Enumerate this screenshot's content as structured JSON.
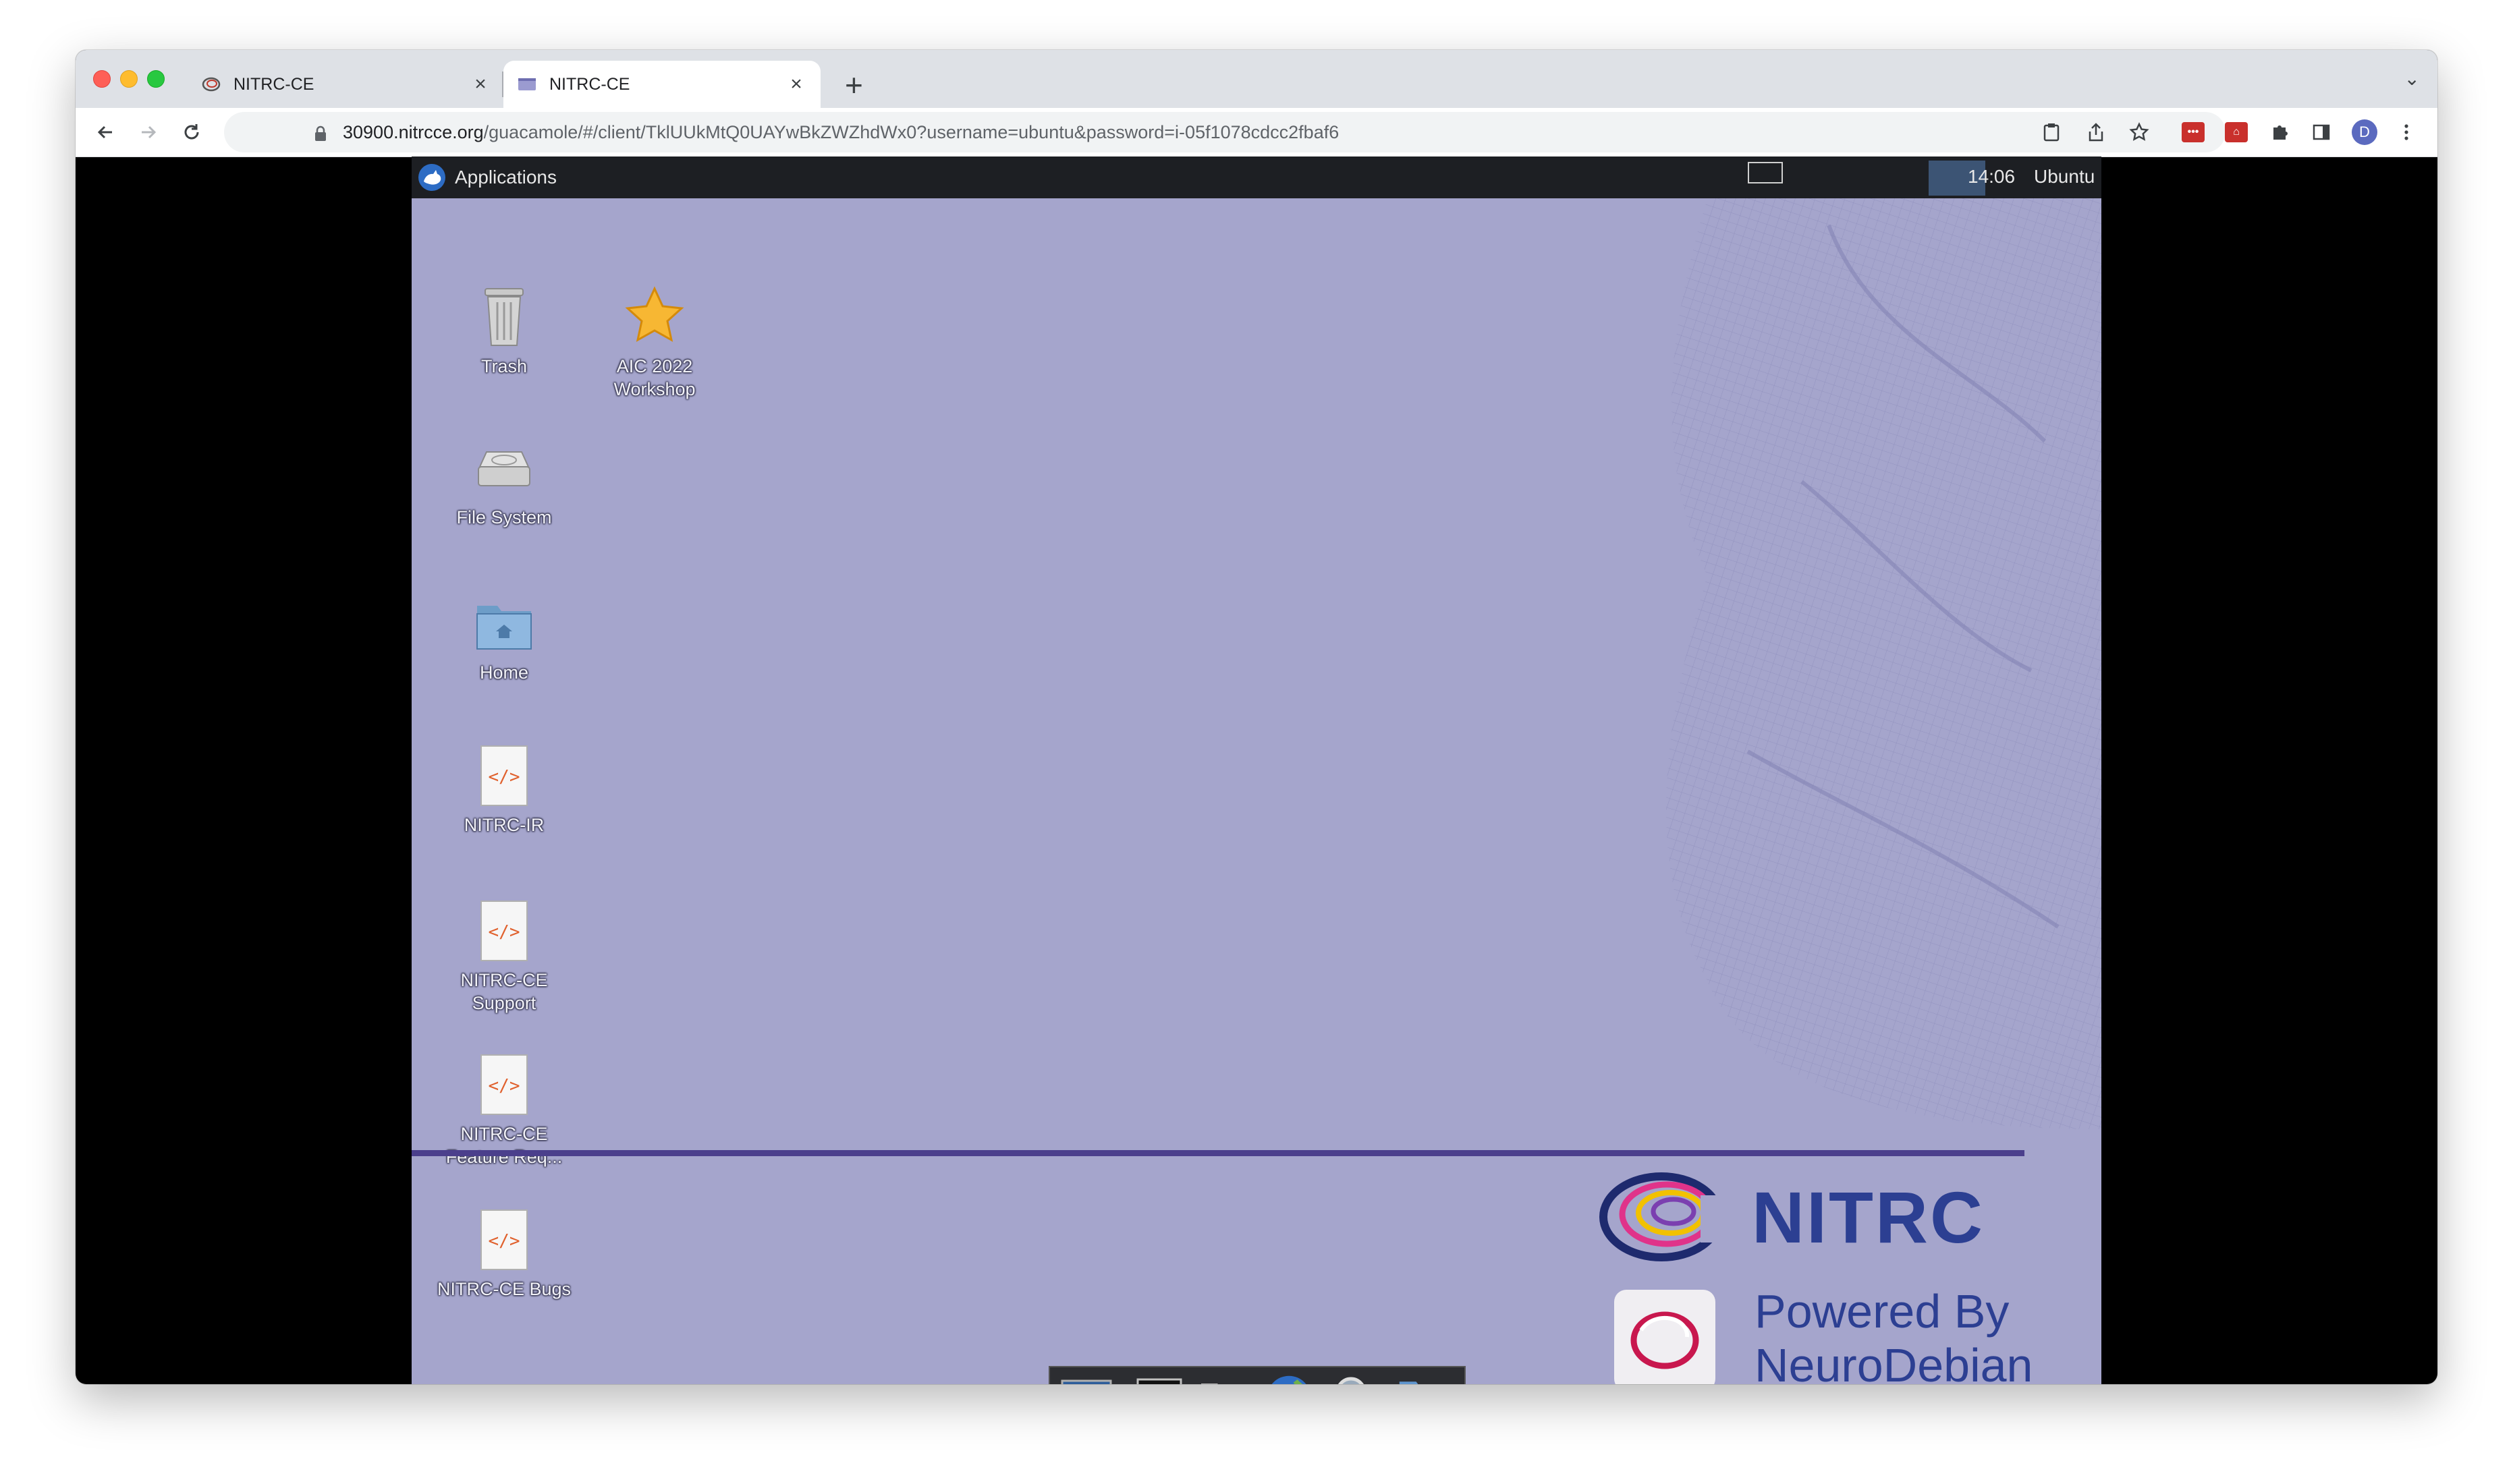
{
  "browser": {
    "tabs": [
      {
        "title": "NITRC-CE",
        "close": "×",
        "favicon": "nitrc-swirl-icon"
      },
      {
        "title": "NITRC-CE",
        "close": "×",
        "favicon": "guacamole-desktop-icon"
      }
    ],
    "new_tab": "+",
    "tab_search": "⌄",
    "url_host": "30900.nitrcce.org",
    "url_path": "/guacamole/#/client/TklUUkMtQ0UAYwBkZWZhdWx0?username=ubuntu&password=i-05f1078cdcc2fbaf6",
    "profile_initial": "D"
  },
  "desktop": {
    "panel": {
      "applications": "Applications",
      "clock": "14:06",
      "user": "Ubuntu"
    },
    "icons": [
      {
        "label": "Trash",
        "icon": "trash-icon"
      },
      {
        "label": "AIC 2022 Workshop",
        "icon": "star-icon"
      },
      {
        "label": "File System",
        "icon": "drive-icon"
      },
      {
        "label": "Home",
        "icon": "home-folder-icon"
      },
      {
        "label": "NITRC-IR",
        "icon": "html-file-icon"
      },
      {
        "label": "NITRC-CE Support",
        "icon": "html-file-icon"
      },
      {
        "label": "NITRC-CE Feature Req...",
        "icon": "html-file-icon"
      },
      {
        "label": "NITRC-CE Bugs",
        "icon": "html-file-icon"
      }
    ],
    "branding": {
      "nitrc": "NITRC",
      "powered_line1": "Powered By",
      "powered_line2": "NeuroDebian"
    },
    "dock": [
      "show-desktop-icon",
      "terminal-icon",
      "home-folder-icon",
      "web-browser-icon",
      "search-icon",
      "folder-icon"
    ]
  },
  "colors": {
    "desktop_bg": "#a5a5cc",
    "panel_bg": "#1d1f23",
    "brand_blue": "#2c3f92"
  }
}
